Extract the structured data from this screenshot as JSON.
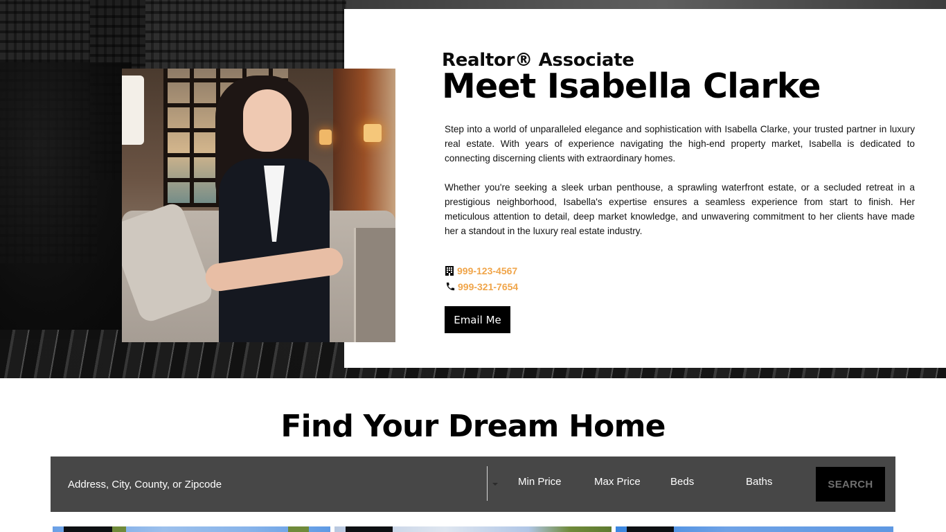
{
  "agent": {
    "subtitle": "Realtor® Associate",
    "title": "Meet Isabella Clarke",
    "bio": [
      "Step into a world of unparalleled elegance and sophistication with Isabella Clarke, your trusted partner in luxury real estate. With years of experience navigating the high-end property market, Isabella is dedicated to connecting discerning clients with extraordinary homes.",
      "Whether you're seeking a sleek urban penthouse, a sprawling waterfront estate, or a secluded retreat in a prestigious neighborhood, Isabella's expertise ensures a seamless experience from start to finish. Her meticulous attention to detail, deep market knowledge, and unwavering commitment to her clients have made her a standout in the luxury real estate industry."
    ],
    "contacts": [
      {
        "icon": "building-icon",
        "phone": "999-123-4567"
      },
      {
        "icon": "phone-icon",
        "phone": "999-321-7654"
      }
    ],
    "email_button": "Email Me",
    "portrait_alt": "Portrait of Isabella Clarke"
  },
  "search": {
    "heading": "Find Your Dream Home",
    "placeholder": "Address, City, County, or Zipcode",
    "filters": [
      "Min Price",
      "Max Price",
      "Beds",
      "Baths"
    ],
    "button": "SEARCH"
  },
  "colors": {
    "accent_phone": "#f0a54a",
    "search_bar_bg": "#474747",
    "button_bg": "#000000"
  },
  "listings": [
    {
      "name": "listing-card-1"
    },
    {
      "name": "listing-card-2"
    },
    {
      "name": "listing-card-3"
    }
  ]
}
